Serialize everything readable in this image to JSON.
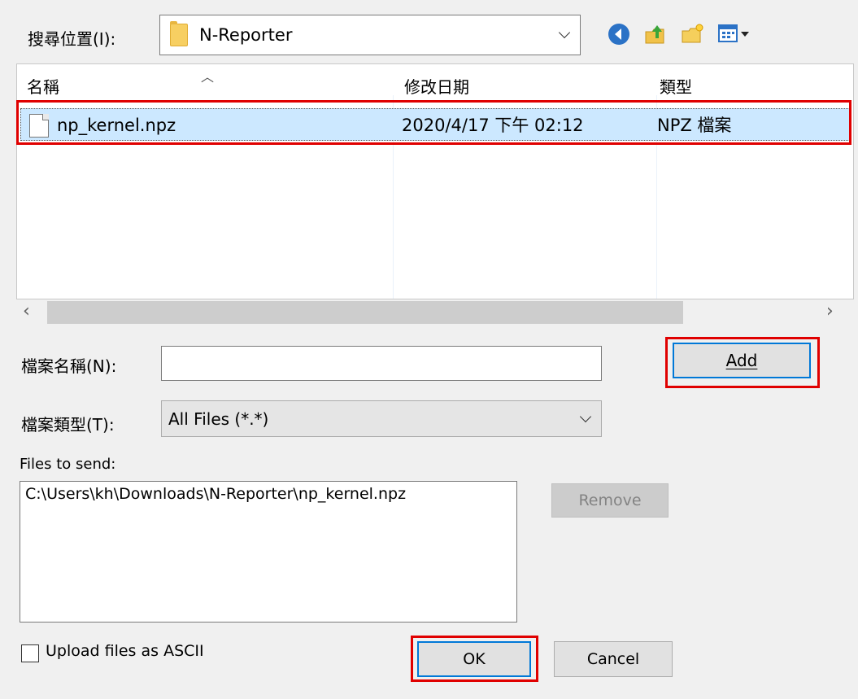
{
  "look_in": {
    "label": "搜尋位置(I):",
    "value": "N-Reporter"
  },
  "toolbar": {
    "icons": [
      "back-icon",
      "up-folder-icon",
      "new-folder-icon",
      "view-menu-icon"
    ]
  },
  "file_list": {
    "columns": [
      "名稱",
      "修改日期",
      "類型"
    ],
    "rows": [
      {
        "name": "np_kernel.npz",
        "modified": "2020/4/17 下午 02:12",
        "type": "NPZ 檔案"
      }
    ]
  },
  "file_name": {
    "label": "檔案名稱(N):",
    "value": ""
  },
  "file_type": {
    "label": "檔案類型(T):",
    "value": "All Files (*.*)"
  },
  "buttons": {
    "add": "Add",
    "remove": "Remove",
    "ok": "OK",
    "cancel": "Cancel"
  },
  "files_to_send": {
    "label": "Files to send:",
    "items": [
      "C:\\Users\\kh\\Downloads\\N-Reporter\\np_kernel.npz"
    ]
  },
  "upload_ascii": {
    "label": "Upload files as ASCII",
    "checked": false
  },
  "colors": {
    "selection": "#cce8ff",
    "highlight": "#e00000",
    "focus_border": "#0078d7"
  }
}
